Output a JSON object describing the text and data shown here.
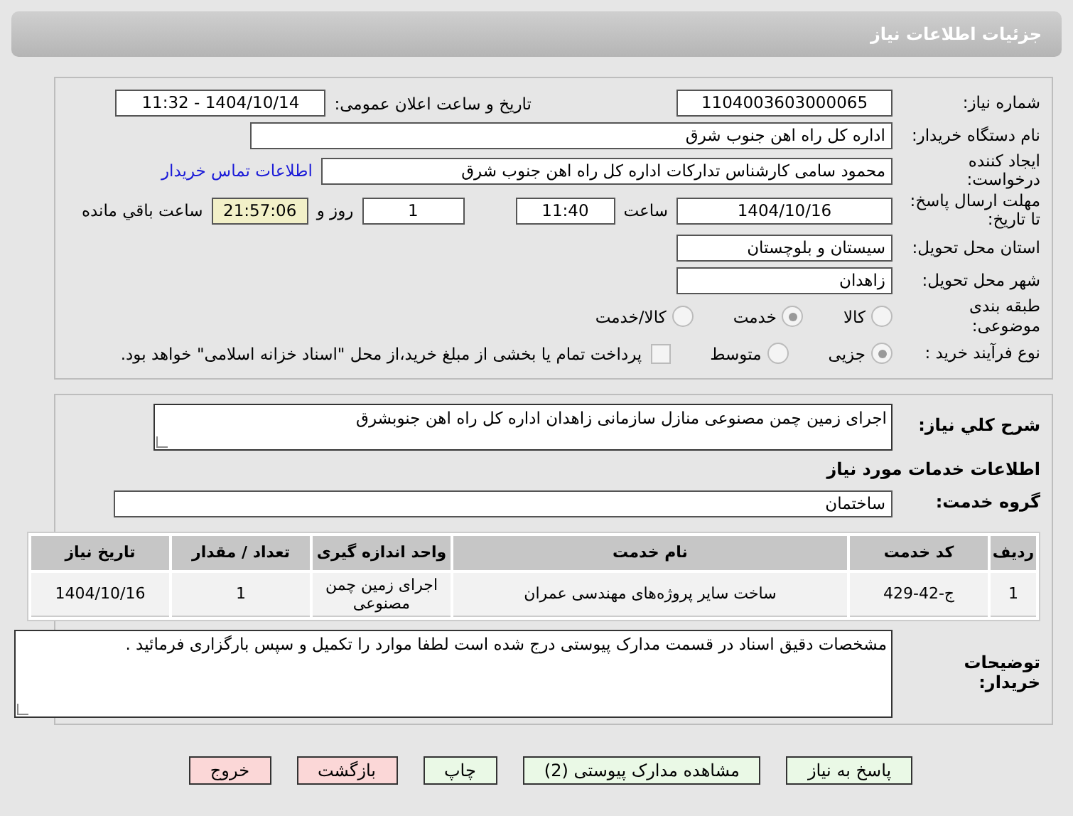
{
  "header": {
    "title": "جزئیات اطلاعات نیاز"
  },
  "need": {
    "number": {
      "label": "شماره نیاز:",
      "value": "1104003603000065"
    },
    "announce": {
      "label": "تاریخ و ساعت اعلان عمومی:",
      "value": "1404/10/14 - 11:32"
    },
    "buyer_org": {
      "label": "نام دستگاه خریدار:",
      "value": "اداره کل راه اهن جنوب شرق"
    },
    "requester": {
      "label": "ایجاد کننده درخواست:",
      "value": "محمود سامی  کارشناس تدارکات  اداره کل راه اهن جنوب شرق",
      "link": "اطلاعات تماس خریدار"
    },
    "deadline": {
      "label": "مهلت ارسال پاسخ: تا تاریخ:",
      "date": "1404/10/16",
      "time_label": "ساعت",
      "time": "11:40",
      "days": "1",
      "days_label": "روز و",
      "remaining": "21:57:06",
      "remaining_label": "ساعت باقي مانده"
    },
    "province": {
      "label": "استان محل تحویل:",
      "value": "سیستان و بلوچستان"
    },
    "city": {
      "label": "شهر محل تحویل:",
      "value": "زاهدان"
    },
    "category": {
      "label": "طبقه بندی موضوعی:",
      "options": [
        {
          "label": "کالا",
          "selected": false
        },
        {
          "label": "خدمت",
          "selected": true
        },
        {
          "label": "کالا/خدمت",
          "selected": false
        }
      ]
    },
    "process": {
      "label": "نوع فرآیند خرید :",
      "options": [
        {
          "label": "جزیی",
          "selected": true
        },
        {
          "label": "متوسط",
          "selected": false
        }
      ],
      "payment": {
        "checked": false,
        "text": "پرداخت تمام یا بخشی از مبلغ خرید،از محل \"اسناد خزانه اسلامی\" خواهد بود."
      }
    }
  },
  "details": {
    "description": {
      "label": "شرح کلي نیاز:",
      "value": "اجرای زمین چمن مصنوعی منازل سازمانی زاهدان اداره کل راه اهن جنوبشرق"
    },
    "services_heading": "اطلاعات خدمات مورد نیاز",
    "group": {
      "label": "گروه خدمت:",
      "value": "ساختمان"
    },
    "table": {
      "columns": [
        "ردیف",
        "کد خدمت",
        "نام خدمت",
        "واحد اندازه گیری",
        "تعداد / مقدار",
        "تاریخ نیاز"
      ],
      "rows": [
        [
          "1",
          "ج-42-429",
          "ساخت سایر پروژه‌های مهندسی عمران",
          "اجرای زمین چمن مصنوعی",
          "1",
          "1404/10/16"
        ]
      ]
    },
    "notes": {
      "label": "توضیحات خریدار:",
      "value": "مشخصات دقیق اسناد در قسمت مدارک پیوستی درج شده است لطفا موارد را تکمیل و سپس بارگزاری فرمائید ."
    }
  },
  "buttons": [
    {
      "label": "پاسخ به نیاز",
      "kind": "green"
    },
    {
      "label": "مشاهده مدارک پیوستی (2)",
      "kind": "green"
    },
    {
      "label": "چاپ",
      "kind": "green"
    },
    {
      "label": "بازگشت",
      "kind": "red"
    },
    {
      "label": "خروج",
      "kind": "red"
    }
  ]
}
